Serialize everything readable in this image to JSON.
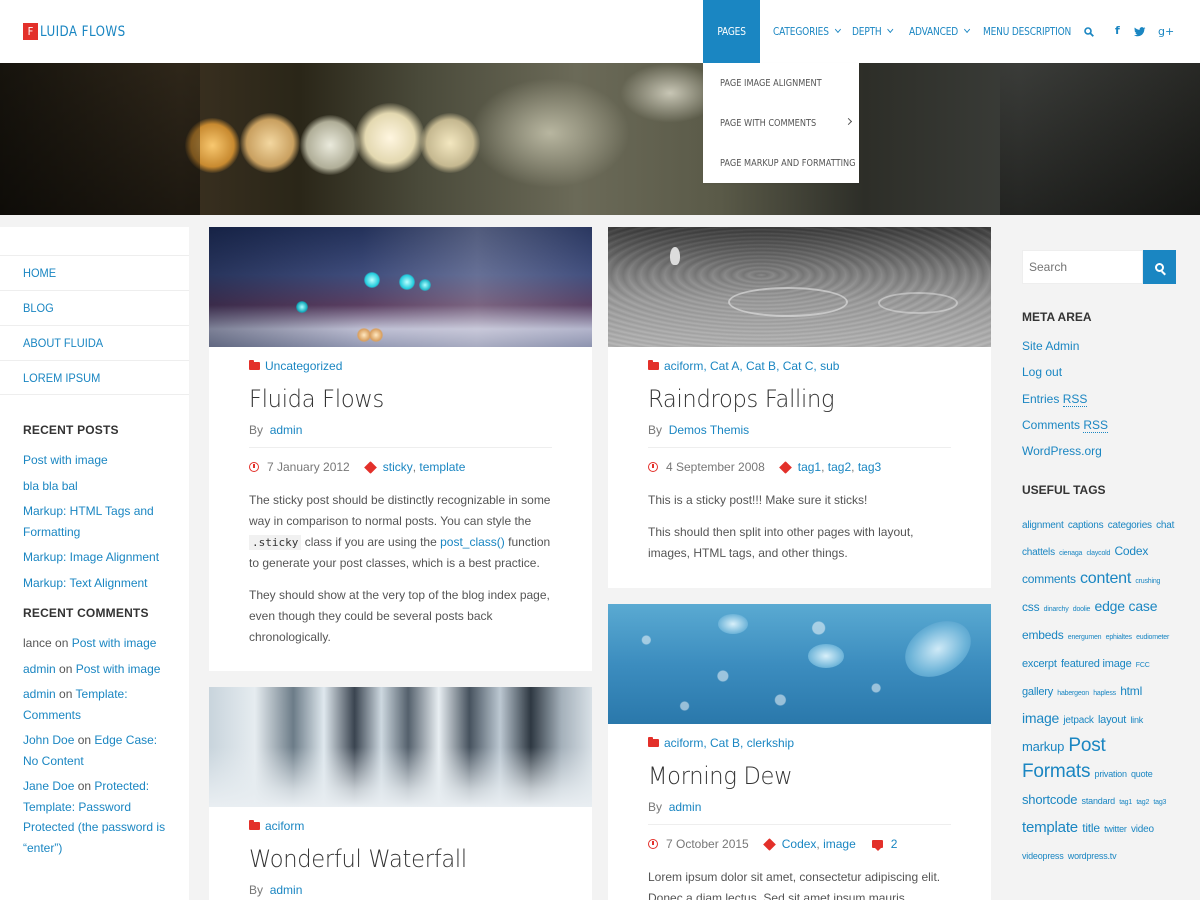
{
  "site": {
    "logo_letter": "F",
    "title": "LUIDA FLOWS"
  },
  "nav": {
    "items": [
      {
        "label": "Pages"
      },
      {
        "label": "Categories"
      },
      {
        "label": "Depth"
      },
      {
        "label": "Advanced"
      },
      {
        "label": "Menu Description"
      }
    ],
    "dropdown": [
      {
        "label": "Page Image Alignment"
      },
      {
        "label": "Page with comments"
      },
      {
        "label": "Page Markup and Formatting"
      }
    ],
    "social": {
      "facebook": "f",
      "twitter": "t",
      "gplus": "g+"
    }
  },
  "left_menu": [
    "HOME",
    "BLOG",
    "ABOUT FLUIDA",
    "LOREM IPSUM"
  ],
  "recent_posts": {
    "title": "RECENT POSTS",
    "items": [
      "Post with image",
      "bla bla bal",
      "Markup: HTML Tags and Formatting",
      "Markup: Image Alignment",
      "Markup: Text Alignment"
    ]
  },
  "recent_comments": {
    "title": "RECENT COMMENTS",
    "items": [
      {
        "author": "lance",
        "on": "on",
        "post": "Post with image"
      },
      {
        "author": "admin",
        "on": "on",
        "post": "Post with image"
      },
      {
        "author": "admin",
        "on": "on",
        "post": "Template: Comments"
      },
      {
        "author": "John Doe",
        "on": "on",
        "post": "Edge Case: No Content"
      },
      {
        "author": "Jane Doe",
        "on": "on",
        "post": "Protected: Template: Password Protected (the password is “enter”)"
      }
    ]
  },
  "posts": [
    {
      "categories": "Uncategorized",
      "title": "Fluida Flows",
      "by": "By",
      "author": "admin",
      "date": "7 January 2012",
      "tags": [
        "sticky",
        "template"
      ],
      "p1a": "The sticky post should be distinctly recognizable in some way in comparison to normal posts. You can style the ",
      "p1code": ".sticky",
      "p1b": " class if you are using the ",
      "p1link": "post_class()",
      "p1c": " function to generate your post classes, which is a best practice.",
      "p2": "They should show at the very top of the blog index page, even though they could be several posts back chronologically."
    },
    {
      "categories": [
        "aciform",
        "Cat A",
        "Cat B",
        "Cat C",
        "sub"
      ],
      "title": "Raindrops Falling",
      "by": "By",
      "author": "Demos Themis",
      "date": "4 September 2008",
      "tags": [
        "tag1",
        "tag2",
        "tag3"
      ],
      "p1": "This is a sticky post!!! Make sure it sticks!",
      "p2": "This should then split into other pages with layout, images, HTML tags, and other things."
    },
    {
      "categories": [
        "aciform",
        "Cat B",
        "clerkship"
      ],
      "title": "Morning Dew",
      "by": "By",
      "author": "admin",
      "date": "7 October 2015",
      "tags": [
        "Codex",
        "image"
      ],
      "comments": "2",
      "p1": "Lorem ipsum dolor sit amet, consectetur adipiscing elit. Donec a diam lectus. Sed sit amet ipsum mauris. Maecenas"
    },
    {
      "categories": "aciform",
      "title": "Wonderful Waterfall",
      "by": "By",
      "author": "admin"
    }
  ],
  "right": {
    "search_placeholder": "Search",
    "meta_title": "META AREA",
    "meta": [
      "Site Admin",
      "Log out",
      "Entries ",
      "Comments ",
      "WordPress.org"
    ],
    "rss": "RSS",
    "tags_title": "USEFUL TAGS",
    "tags": [
      {
        "t": "alignment",
        "s": 10
      },
      {
        "t": "captions",
        "s": 10
      },
      {
        "t": "categories",
        "s": 10
      },
      {
        "t": "chat",
        "s": 10
      },
      {
        "t": "chattels",
        "s": 10
      },
      {
        "t": "cienaga",
        "s": 7
      },
      {
        "t": "claycold",
        "s": 7
      },
      {
        "t": "Codex",
        "s": 12
      },
      {
        "t": "comments",
        "s": 12
      },
      {
        "t": "content",
        "s": 16
      },
      {
        "t": "crushing",
        "s": 7
      },
      {
        "t": "css",
        "s": 12
      },
      {
        "t": "dinarchy",
        "s": 7
      },
      {
        "t": "doolie",
        "s": 7
      },
      {
        "t": "edge case",
        "s": 14
      },
      {
        "t": "embeds",
        "s": 12
      },
      {
        "t": "energumen",
        "s": 7
      },
      {
        "t": "ephialtes",
        "s": 7
      },
      {
        "t": "eudiometer",
        "s": 7
      },
      {
        "t": "excerpt",
        "s": 11
      },
      {
        "t": "featured image",
        "s": 11
      },
      {
        "t": "FCC",
        "s": 7
      },
      {
        "t": "gallery",
        "s": 11
      },
      {
        "t": "habergeon",
        "s": 7
      },
      {
        "t": "hapless",
        "s": 7
      },
      {
        "t": "html",
        "s": 12
      },
      {
        "t": "image",
        "s": 14
      },
      {
        "t": "jetpack",
        "s": 10
      },
      {
        "t": "layout",
        "s": 11
      },
      {
        "t": "link",
        "s": 9
      },
      {
        "t": "markup",
        "s": 13
      },
      {
        "t": "Post",
        "s": 19
      },
      {
        "t": "Formats",
        "s": 19
      },
      {
        "t": "privation",
        "s": 9
      },
      {
        "t": "quote",
        "s": 9
      },
      {
        "t": "shortcode",
        "s": 13
      },
      {
        "t": "standard",
        "s": 9
      },
      {
        "t": "tag1",
        "s": 7
      },
      {
        "t": "tag2",
        "s": 7
      },
      {
        "t": "tag3",
        "s": 7
      },
      {
        "t": "template",
        "s": 15
      },
      {
        "t": "title",
        "s": 12
      },
      {
        "t": "twitter",
        "s": 9
      },
      {
        "t": "video",
        "s": 10
      },
      {
        "t": "videopress",
        "s": 9
      },
      {
        "t": "wordpress.tv",
        "s": 9
      }
    ]
  }
}
